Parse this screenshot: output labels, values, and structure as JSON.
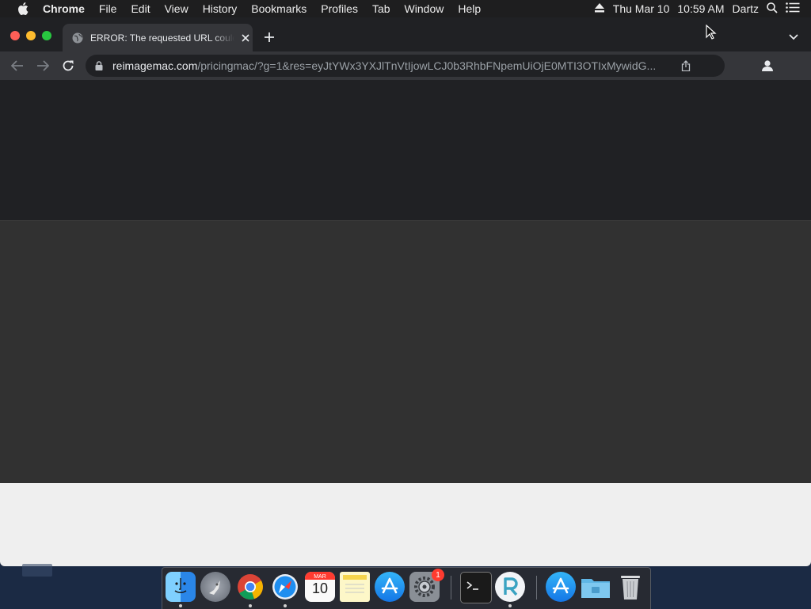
{
  "menubar": {
    "app_name": "Chrome",
    "items": [
      "File",
      "Edit",
      "View",
      "History",
      "Bookmarks",
      "Profiles",
      "Tab",
      "Window",
      "Help"
    ],
    "date": "Thu Mar 10",
    "time": "10:59 AM",
    "user": "Dartz"
  },
  "browser": {
    "tab_title": "ERROR: The requested URL could not be retrieved",
    "url_host": "reimagemac.com",
    "url_path": "/pricingmac/?g=1&res=eyJtYWx3YXJlTnVtIjowLCJ0b3RhbFNpemUiOjE0MTI3OTIxMywidG..."
  },
  "dock": {
    "apps": [
      "finder-icon",
      "launchpad-icon",
      "chrome-icon",
      "safari-icon",
      "calendar-icon",
      "notes-icon",
      "app-store-icon",
      "system-preferences-icon",
      "terminal-icon",
      "reimage-icon",
      "app-store-icon",
      "folder-icon",
      "trash-icon"
    ],
    "calendar_month": "MAR",
    "calendar_day": "10",
    "system_preferences_badge": "1"
  },
  "colors": {
    "menubar_bg": "#1e1e1f",
    "tab_active_bg": "#35363a",
    "omnibox_bg": "#202124",
    "content_top": "#202124",
    "content_mid": "#313131",
    "content_bottom": "#efefef",
    "close_red": "#fe5f57",
    "minimize_yellow": "#febc2e",
    "zoom_green": "#28c840"
  }
}
